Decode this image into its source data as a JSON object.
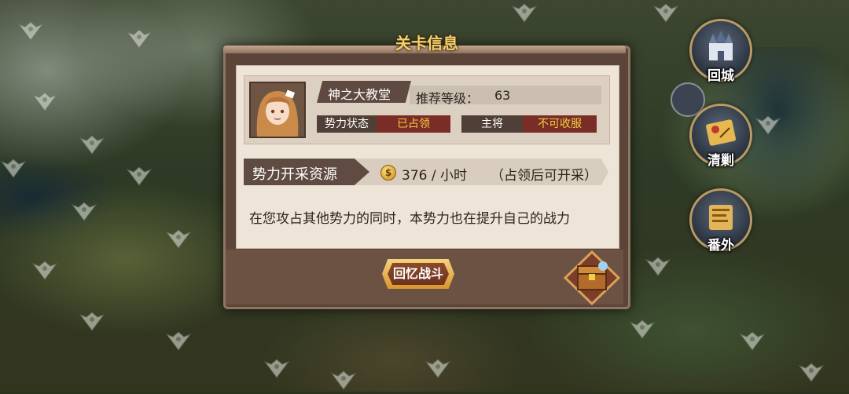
{
  "dialog": {
    "title": "关卡信息",
    "stage_name": "神之大教堂",
    "recommended_level_label": "推荐等级：",
    "recommended_level_value": "63",
    "faction_status_label": "势力状态",
    "faction_status_value": "已占领",
    "general_label": "主将",
    "general_value": "不可收服",
    "resource_title": "势力开采资源",
    "resource_rate": "376 / 小时",
    "resource_note": "（占领后可开采）",
    "description": "在您攻占其他势力的同时，本势力也在提升自己的战力",
    "recall_button": "回忆战斗"
  },
  "side_buttons": {
    "return_city": "回城",
    "clear": "清剿",
    "extra": "番外"
  },
  "colors": {
    "title_gold": "#f5d26a",
    "status_red": "#7a2c26",
    "status_text_yellow": "#f4d03f",
    "dialog_brown": "#5b4538",
    "paper": "#eee4d7"
  },
  "icons": [
    "castle-icon",
    "treasure-map-icon",
    "scroll-icon",
    "coin-icon",
    "treasure-chest-icon",
    "map-emblem-icon"
  ]
}
